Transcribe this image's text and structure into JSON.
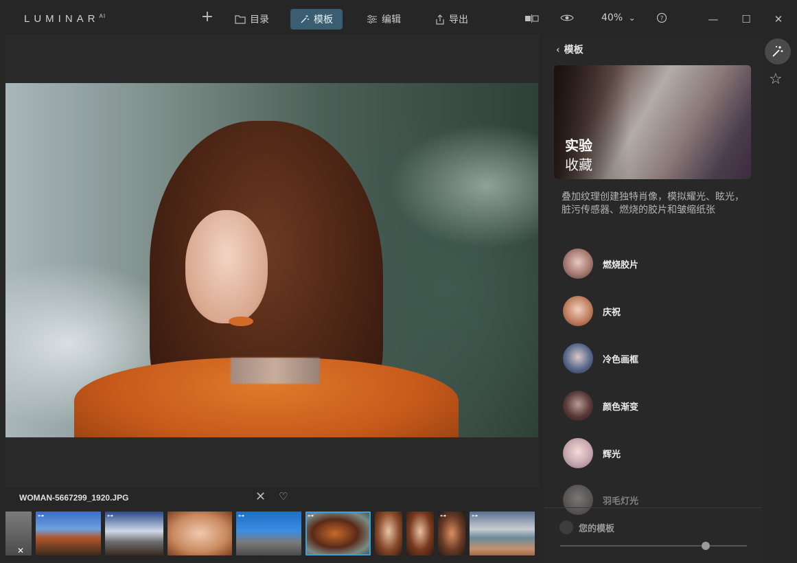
{
  "app": {
    "logo": "LUMINAR",
    "logo_sup": "AI"
  },
  "toolbar": {
    "add_icon": "+",
    "catalog_label": "目录",
    "templates_label": "模板",
    "edit_label": "编辑",
    "export_label": "导出",
    "zoom_value": "40%",
    "zoom_arrow": "⌄"
  },
  "window_controls": {
    "minimize": "—",
    "maximize": "☐",
    "close": "✕"
  },
  "viewer": {
    "filename": "WOMAN-5667299_1920.JPG",
    "close_glyph": "✕",
    "favorite_glyph": "♡"
  },
  "filmstrip": {
    "remove_glyph": "✕",
    "thumbs": [
      {
        "name": "thumb-1",
        "selected": false
      },
      {
        "name": "thumb-2-mountain",
        "selected": false
      },
      {
        "name": "thumb-3-sky",
        "selected": false
      },
      {
        "name": "thumb-4-portrait",
        "selected": false
      },
      {
        "name": "thumb-5-road",
        "selected": false
      },
      {
        "name": "thumb-6-woman",
        "selected": true
      },
      {
        "name": "thumb-7-portrait",
        "selected": false
      },
      {
        "name": "thumb-8-portrait",
        "selected": false
      },
      {
        "name": "thumb-9-portrait",
        "selected": false
      },
      {
        "name": "thumb-10-beach",
        "selected": false
      }
    ]
  },
  "panel": {
    "back_label": "模板",
    "hero_title_1": "实验",
    "hero_title_2": "收藏",
    "description": "叠加纹理创建独特肖像，模拟耀光、眩光，脏污传感器、燃烧的胶片和皱缩纸张",
    "items": [
      {
        "label": "燃烧胶片"
      },
      {
        "label": "庆祝"
      },
      {
        "label": "冷色画框"
      },
      {
        "label": "颜色渐变"
      },
      {
        "label": "辉光"
      },
      {
        "label": "羽毛灯光"
      }
    ],
    "your_templates": "您的模板",
    "slider_value": 0.78
  },
  "rail": {
    "templates_icon": "wand-icon",
    "favorites_icon": "star-icon"
  }
}
